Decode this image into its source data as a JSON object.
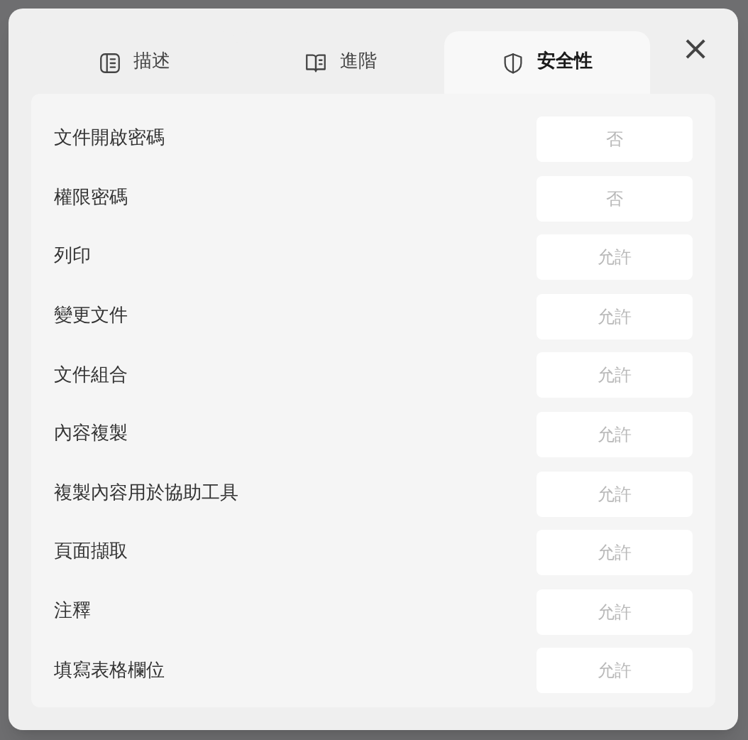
{
  "tabs": [
    {
      "label": "描述",
      "kind": "panel",
      "selected": false
    },
    {
      "label": "進階",
      "kind": "book",
      "selected": false
    },
    {
      "label": "安全性",
      "kind": "shield",
      "selected": true
    }
  ],
  "close": "×",
  "rows": [
    {
      "label": "文件開啟密碼",
      "value": "否"
    },
    {
      "label": "權限密碼",
      "value": "否"
    },
    {
      "label": "列印",
      "value": "允許"
    },
    {
      "label": "變更文件",
      "value": "允許"
    },
    {
      "label": "文件組合",
      "value": "允許"
    },
    {
      "label": "內容複製",
      "value": "允許"
    },
    {
      "label": "複製內容用於協助工具",
      "value": "允許"
    },
    {
      "label": "頁面擷取",
      "value": "允許"
    },
    {
      "label": "注釋",
      "value": "允許"
    },
    {
      "label": "填寫表格欄位",
      "value": "允許"
    }
  ]
}
